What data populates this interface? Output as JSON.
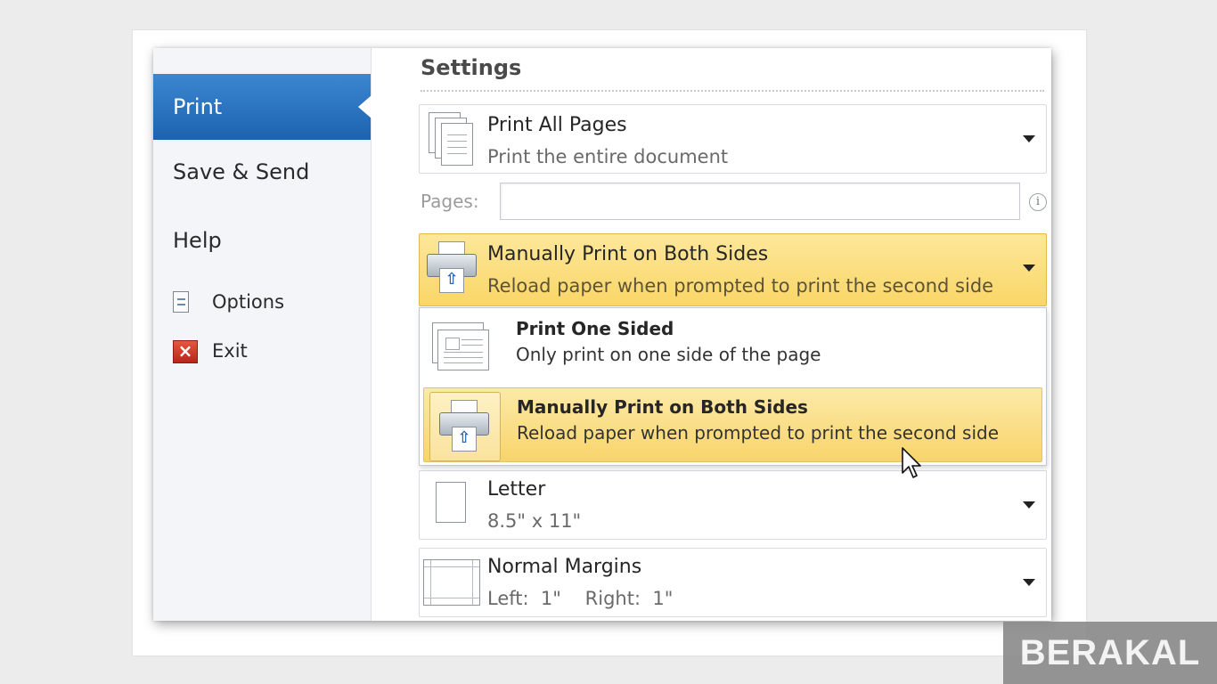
{
  "nav": {
    "print_label": "Print",
    "save_send_label": "Save & Send",
    "help_label": "Help",
    "options_label": "Options",
    "exit_label": "Exit",
    "options_icon": "options-doc-icon",
    "exit_icon": "exit-x-icon"
  },
  "settings": {
    "title": "Settings",
    "print_range": {
      "title": "Print All Pages",
      "subtitle": "Print the entire document",
      "icon": "pages-stack-icon"
    },
    "pages": {
      "label": "Pages:",
      "value": "",
      "info_icon": "info-icon"
    },
    "duplex": {
      "title": "Manually Print on Both Sides",
      "subtitle": "Reload paper when prompted to print the second side",
      "icon": "printer-duplex-icon",
      "selected_color": "#f9d667"
    },
    "paper_size": {
      "title": "Letter",
      "subtitle": "8.5\" x 11\"",
      "icon": "paper-icon"
    },
    "margins": {
      "title": "Normal Margins",
      "subtitle": "Left:  1\"    Right:  1\"",
      "icon": "margins-icon"
    }
  },
  "dropdown": {
    "items": [
      {
        "title": "Print One Sided",
        "subtitle": "Only print on one side of the page",
        "icon": "single-sided-icon"
      },
      {
        "title": "Manually Print on Both Sides",
        "subtitle": "Reload paper when prompted to print the second side",
        "icon": "printer-duplex-icon",
        "highlighted": true
      }
    ]
  },
  "watermark": {
    "text": "BERAKAL"
  },
  "colors": {
    "accent_blue": "#1c62b0",
    "highlight_yellow": "#f9d667"
  }
}
